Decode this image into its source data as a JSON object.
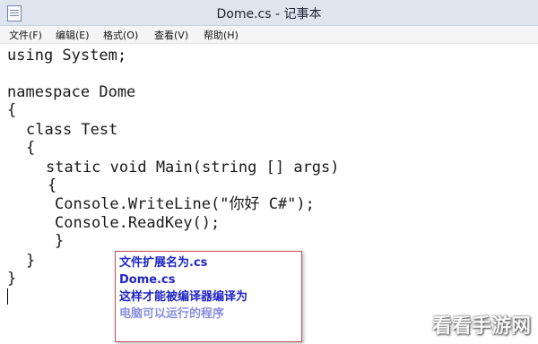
{
  "window": {
    "title": "Dome.cs - 记事本"
  },
  "menu": [
    "文件(F)",
    "编辑(E)",
    "格式(O)",
    "查看(V)",
    "帮助(H)"
  ],
  "code": [
    "using System;",
    "namespace Dome",
    "{",
    "class Test",
    "{",
    "static void Main(string [] args)",
    "{",
    "Console.WriteLine(\"你好 C#\");",
    "Console.ReadKey();",
    "}",
    "}",
    "}"
  ],
  "callout": [
    "文件扩展名为.cs",
    "Dome.cs",
    "这样才能被编译器编译为",
    "电脑可以运行的程序"
  ],
  "watermark": "看看手游网",
  "colors": {
    "callout_text": "#1f25c6",
    "callout_border": "#c84a55",
    "titlebar": "#dfe5ee"
  }
}
